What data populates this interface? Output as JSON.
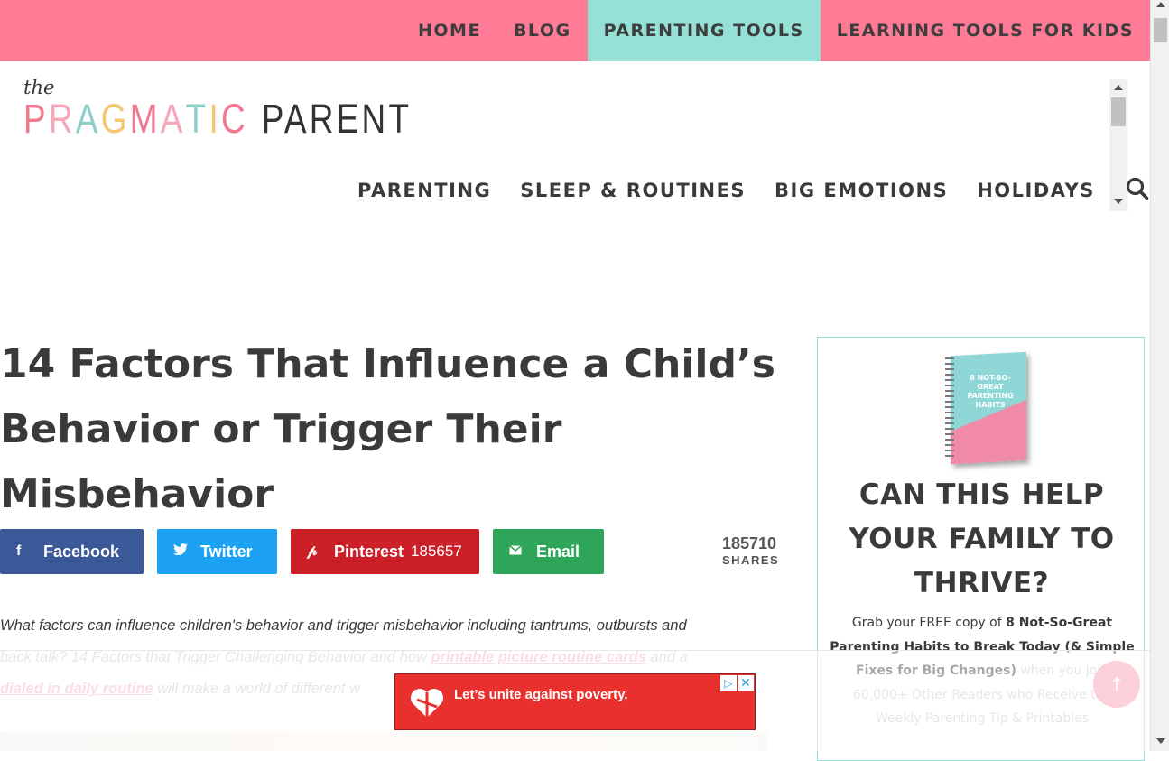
{
  "topnav": {
    "items": [
      {
        "label": "HOME"
      },
      {
        "label": "BLOG"
      },
      {
        "label": "PARENTING TOOLS",
        "active": true
      },
      {
        "label": "LEARNING TOOLS FOR KIDS"
      }
    ]
  },
  "logo": {
    "the": "the",
    "word1": "PRAGMATIC",
    "word2": "PARENT",
    "letter_colors": [
      "#f2788f",
      "#f6a7b8",
      "#8ccfc9",
      "#f4c872",
      "#f2788f",
      "#f6a7b8",
      "#8ccfc9",
      "#f4c872",
      "#f2788f"
    ]
  },
  "mainnav": {
    "items": [
      "PARENTING",
      "SLEEP & ROUTINES",
      "BIG EMOTIONS",
      "HOLIDAYS"
    ],
    "search_icon": "search-icon"
  },
  "article": {
    "title": "14 Factors That Influence a Child’s Behavior or Trigger Their Misbehavior",
    "share": {
      "facebook": "Facebook",
      "twitter": "Twitter",
      "pinterest": "Pinterest",
      "pinterest_count": "185657",
      "email": "Email",
      "total": "185710",
      "total_label": "SHARES"
    },
    "intro_1": "What factors can influence children's behavior and trigger misbehavior including tantrums, outbursts and",
    "intro_2a": "back talk? 14 Factors that Trigger Challenging Behavior and how ",
    "intro_link1": "printable picture routine cards",
    "intro_2b": " and a",
    "intro_link2": "dialed in daily routine",
    "intro_3": " will make a world of different w"
  },
  "sidebar": {
    "book_text": "8 NOT-SO-GREAT PARENTING HABITS",
    "heading": "CAN THIS HELP YOUR FAMILY TO THRIVE?",
    "desc_1": "Grab your FREE copy of ",
    "desc_bold": "8 Not-So-Great Parenting Habits to Break Today (& Simple Fixes for Big Changes)",
    "desc_2": " when you join 60,000+ Other Readers who Receive the Weekly Parenting Tip & Printables"
  },
  "ad": {
    "message": "Let’s unite against poverty.",
    "adchoices": "▷",
    "close": "✕"
  },
  "colors": {
    "topbar": "#ff7b96",
    "active_tab": "#95e1d6",
    "facebook": "#3b5998",
    "twitter": "#1da1f2",
    "pinterest": "#cb2027",
    "email": "#2ea559",
    "ad": "#e8312f"
  }
}
